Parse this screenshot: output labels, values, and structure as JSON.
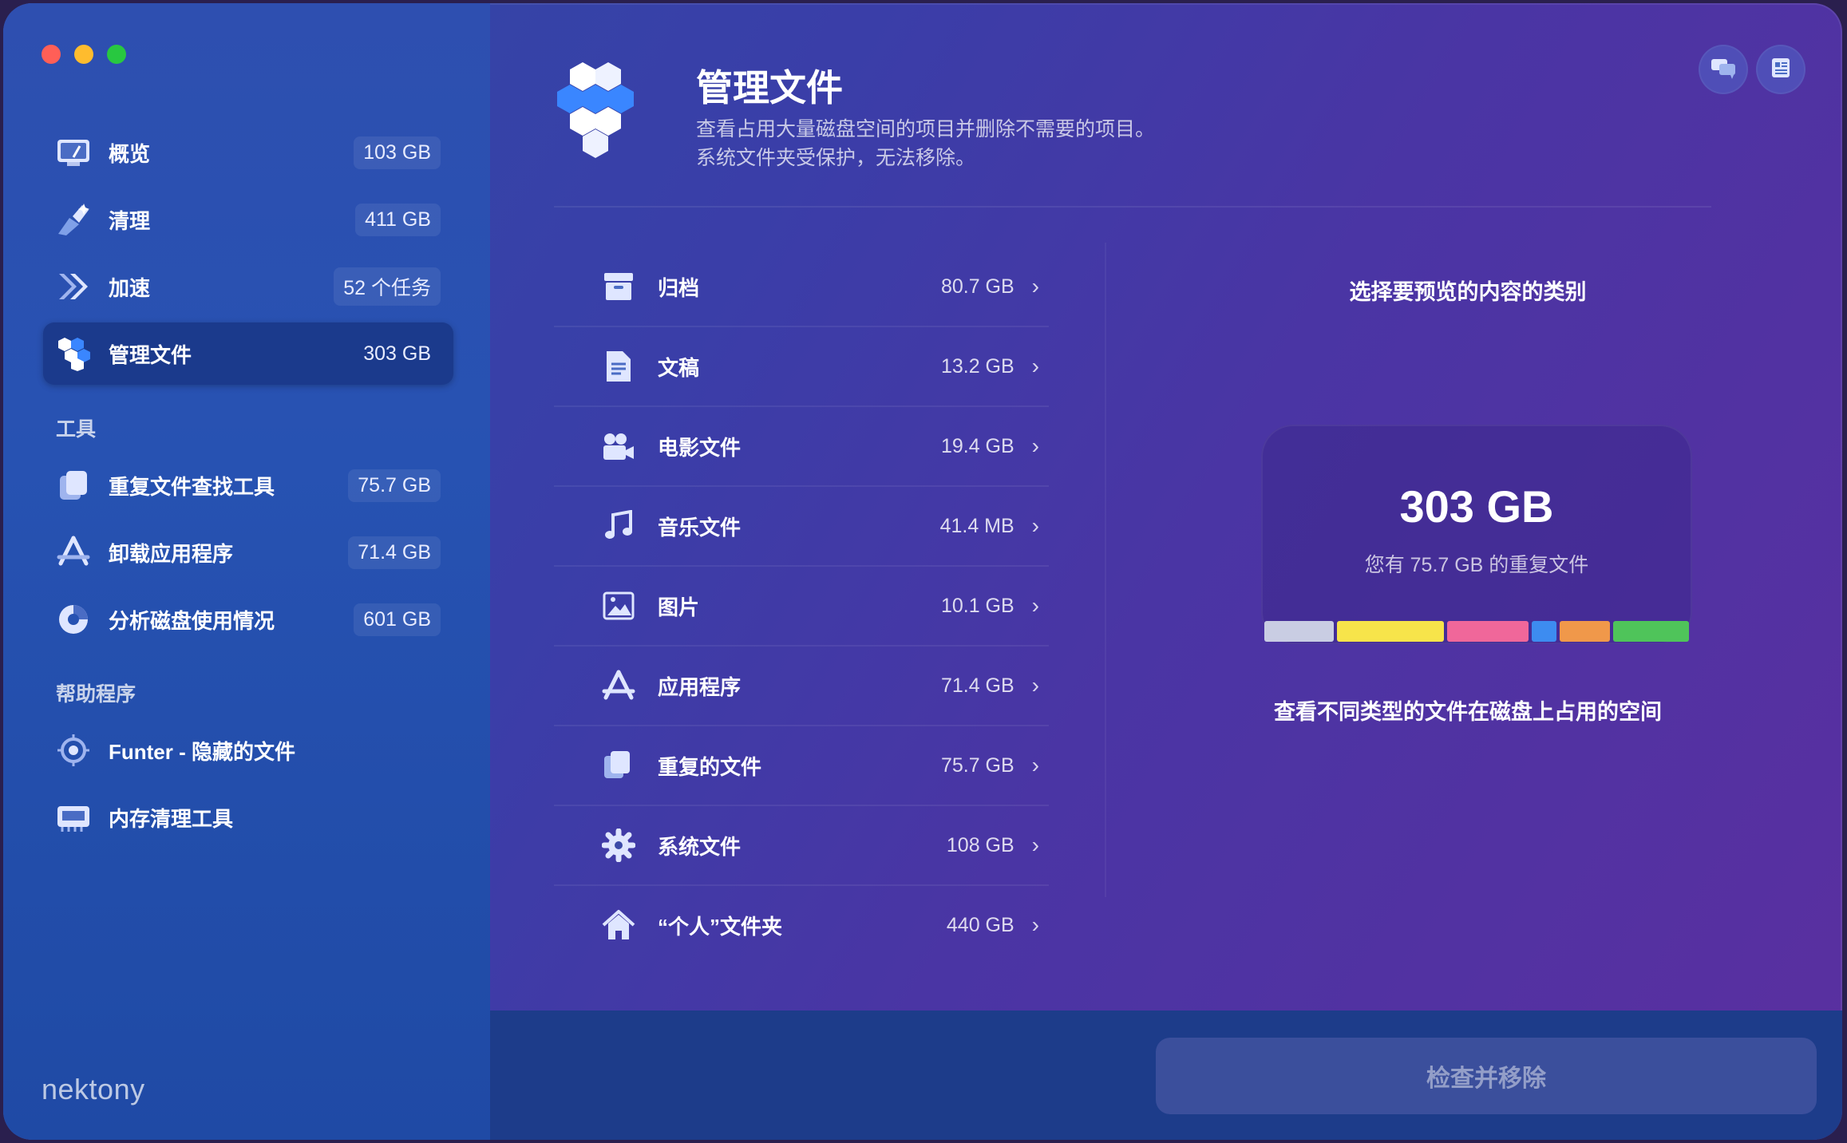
{
  "window": {
    "traffic_lights": [
      "close",
      "minimize",
      "zoom"
    ]
  },
  "sidebar": {
    "main_items": [
      {
        "label": "概览",
        "badge": "103 GB",
        "icon": "dashboard-icon"
      },
      {
        "label": "清理",
        "badge": "411 GB",
        "icon": "broom-icon"
      },
      {
        "label": "加速",
        "badge": "52 个任务",
        "icon": "speed-icon"
      },
      {
        "label": "管理文件",
        "badge": "303 GB",
        "icon": "hexagon-icon",
        "active": true
      }
    ],
    "tools_title": "工具",
    "tools": [
      {
        "label": "重复文件查找工具",
        "badge": "75.7 GB",
        "icon": "duplicate-icon"
      },
      {
        "label": "卸载应用程序",
        "badge": "71.4 GB",
        "icon": "app-uninstall-icon"
      },
      {
        "label": "分析磁盘使用情况",
        "badge": "601 GB",
        "icon": "disk-usage-icon"
      }
    ],
    "helpers_title": "帮助程序",
    "helpers": [
      {
        "label": "Funter - 隐藏的文件",
        "icon": "funter-icon"
      },
      {
        "label": "内存清理工具",
        "icon": "memory-icon"
      }
    ],
    "brand": "nektony"
  },
  "header": {
    "title": "管理文件",
    "desc_line1": "查看占用大量磁盘空间的项目并删除不需要的项目。",
    "desc_line2": "系统文件夹受保护，无法移除。"
  },
  "categories": [
    {
      "label": "归档",
      "size": "80.7 GB",
      "icon": "archive-icon"
    },
    {
      "label": "文稿",
      "size": "13.2 GB",
      "icon": "document-icon"
    },
    {
      "label": "电影文件",
      "size": "19.4 GB",
      "icon": "movie-icon"
    },
    {
      "label": "音乐文件",
      "size": "41.4 MB",
      "icon": "music-icon"
    },
    {
      "label": "图片",
      "size": "10.1 GB",
      "icon": "picture-icon"
    },
    {
      "label": "应用程序",
      "size": "71.4 GB",
      "icon": "app-icon"
    },
    {
      "label": "重复的文件",
      "size": "75.7 GB",
      "icon": "duplicate-files-icon"
    },
    {
      "label": "系统文件",
      "size": "108 GB",
      "icon": "gear-icon"
    },
    {
      "label": "“个人”文件夹",
      "size": "440 GB",
      "icon": "home-icon"
    }
  ],
  "chevron": "›",
  "preview": {
    "title": "选择要预览的内容的类别",
    "total": "303 GB",
    "subtitle": "您有 75.7 GB 的重复文件",
    "caption": "查看不同类型的文件在磁盘上占用的空间",
    "bar_segments": [
      {
        "color": "#c9cde3",
        "weight": 11
      },
      {
        "color": "#f7e44a",
        "weight": 17
      },
      {
        "color": "#f0679a",
        "weight": 13
      },
      {
        "color": "#3d8cf0",
        "weight": 4
      },
      {
        "color": "#f0984a",
        "weight": 8
      },
      {
        "color": "#4fc45a",
        "weight": 12
      }
    ]
  },
  "action_button": "检查并移除",
  "colors": {
    "accent": "#1b3a8c",
    "close": "#ff5f57",
    "minimize": "#febc2e",
    "zoom": "#28c840"
  }
}
